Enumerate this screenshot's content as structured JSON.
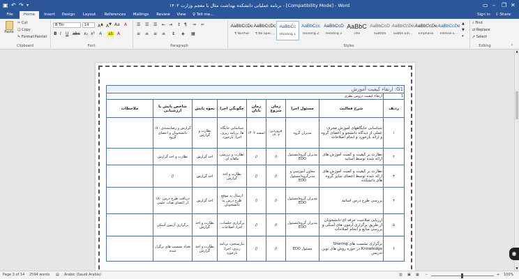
{
  "title_bar": {
    "title": "برنامه عملیاتی دانشکده بهداشت مثال با معجم وزارت ۱۴۰۲ - [Compatibility Mode] - Word",
    "restore_icon": "restore-icon",
    "minimize_icon": "minimize-icon",
    "close_icon": "close-icon"
  },
  "tabs": [
    "File",
    "Home",
    "Insert",
    "Design",
    "Layout",
    "References",
    "Mailings",
    "Review",
    "View"
  ],
  "tell_me": "Tell me...",
  "account": {
    "sign_in": "Sign in",
    "share": "Share"
  },
  "ribbon": {
    "clipboard": {
      "label": "Clipboard",
      "paste": "Paste",
      "cut": "Cut",
      "copy": "Copy",
      "format_painter": "Format Painter"
    },
    "font": {
      "label": "Font",
      "name": "B Titr",
      "size": "14",
      "bold": "B",
      "italic": "I",
      "underline": "U"
    },
    "paragraph": {
      "label": "Paragraph"
    },
    "styles": {
      "label": "Styles",
      "items": [
        {
          "sample": "AaBbCcDc",
          "name": "¶ Normal"
        },
        {
          "sample": "AaBbCcDc",
          "name": "¶ No Spac..."
        },
        {
          "sample": "AaBbCc",
          "name": "Heading 1"
        },
        {
          "sample": "AaBbCcc",
          "name": "Heading 2"
        },
        {
          "sample": "AaBbCcD",
          "name": "Heading 3"
        },
        {
          "sample": "AaBbC",
          "name": "Title"
        },
        {
          "sample": "AaBbCcD",
          "name": "Subtitle"
        },
        {
          "sample": "AaBbCcDe",
          "name": "Subtle Em..."
        },
        {
          "sample": "AaBbCcDe",
          "name": "Emphasis"
        },
        {
          "sample": "AaBbCcDe",
          "name": "Intense E..."
        }
      ]
    },
    "editing": {
      "label": "Editing",
      "find": "Find",
      "replace": "Replace",
      "select": "Select"
    }
  },
  "table": {
    "title": "G1: ارتقاء کیفیت آموزش",
    "subtitle_num": "1",
    "subtitle": "ارتقاء کیفیت دروس نظری",
    "headers": [
      "ردیف",
      "شرح فعالیت",
      "مسئول اجرا",
      "زمان شروع",
      "زمان پایان",
      "چگونگی اجرا",
      "نحوه پایش",
      "شاخص پایش یا ارزشیابی",
      "ملاحظات"
    ],
    "rows": [
      [
        "۱",
        "شناسایی جایگاههای آموزش مجری-عملی از دیدگاه دانشجو و اعضای گروه و ارائه بازخورد و انجام اصلاحات",
        "مدیران گروه",
        "فروردین ۱۴۰۲",
        "اسفند ۱۴۰۲",
        "شناسایی جایگاه ها، برنامه ریزی، اجرا، بازخورد",
        "نظارت و گزارش",
        "گزارش و رضایتمندی ۷۰٪ دانشجویان و اعضای گروه",
        ""
      ],
      [
        "۲",
        "نظارت بر کیفیت و کمیت آموزش های ارائه شده توسط اساتید",
        "مدیران گروه/مسئول EDO",
        "//",
        "//",
        "نظارت و بررسی ماهانه ای",
        "اخذ گزارش",
        "نظارت و اخذ گزارش",
        ""
      ],
      [
        "۳",
        "نظارت بر کیفیت و کمیت آموزش های ارائه شده توسط اعضای سایر گروه های دانشکده",
        "معاون آموزشی و مدیرگروه/مسئول EDO",
        "//",
        "//",
        "نظارت و اخذ گزارش",
        "اخذ گزارش",
        "//",
        ""
      ],
      [
        "۴",
        "بررسی طرح درس اساتید",
        "مدیران گروه/مسئول EDO",
        "//",
        "//",
        "ارسال به موقع طرح درس به دانشجویان",
        "اخذ گزارش",
        "دریافت طرح درس ۸۰٪ از اعضای هیات علمی",
        ""
      ],
      [
        "۵",
        "ارزیابی صلاحیت حرفه ای دانشجویان از طریق برگزاری آزمون های آسکی و بررسی منابع و انجام اصلاحات",
        "مدیران گروه/مسئول EDO",
        "//",
        "//",
        "برگزاری جلسات، اجرا، اصلاحات",
        "نظارت و اخذ گزارش",
        "برگزاری آزمون آسکی",
        ""
      ],
      [
        "۶",
        "برگزاری نشست های Sharing Knowledge در حوزه روش های نوین تدریس",
        "مسئول EDO",
        "//",
        "//",
        "نیازسنجی، برنامه ریزی، اجرا، بازخورد",
        "نظارت و اخذ گزارش",
        "تعداد نشست های برگزار شده",
        ""
      ]
    ]
  },
  "status": {
    "page": "Page 3 of 14",
    "words": "2594 words",
    "language": "Arabic (Saudi Arabia)",
    "zoom": "100%"
  }
}
